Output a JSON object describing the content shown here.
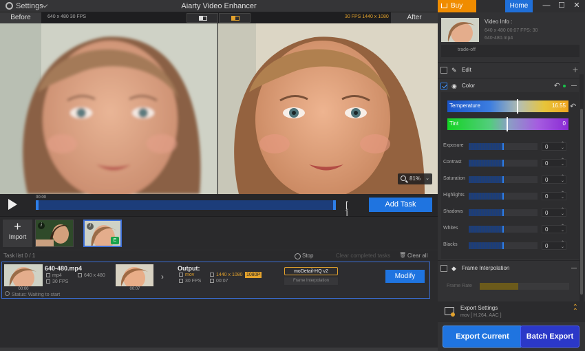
{
  "title_bar": {
    "settings_label": "Settings",
    "app_title": "Aiarty Video Enhancer",
    "buy_now": "Buy Now",
    "home": "Home",
    "minimize": "—",
    "maximize": "☐",
    "close": "✕"
  },
  "compare": {
    "before_label": "Before",
    "before_info": "640 x 480   30 FPS",
    "after_info": "30 FPS   1440 x 1080",
    "after_label": "After",
    "zoom": "81%"
  },
  "timeline": {
    "time_start": "00:00",
    "add_task": "Add Task",
    "in_out": "[ ]"
  },
  "media": {
    "import_label": "Import",
    "badge": "E",
    "info_glyph": "i"
  },
  "tasks": {
    "label": "Task list   0 / 1",
    "stop": "Stop",
    "clear_completed": "Clear completed tasks",
    "clear_all": "Clear all",
    "file_name": "640-480.mp4",
    "src_format": "mp4",
    "src_fps": "30 FPS",
    "src_res": "640 x 480",
    "thumb1_time": "00:00",
    "thumb2_time": "00:07",
    "output_label": "Output:",
    "out_format": "mov",
    "out_fps": "30 FPS",
    "out_res": "1440 x 1080",
    "out_badge": "1080P",
    "out_duration": "00:07",
    "model": "moDetail-HQ  v2",
    "frame_interp": "Frame Interpolation",
    "modify": "Modify",
    "status": "Status: Waiting to start"
  },
  "right_panel": {
    "video_info_title": "Video Info :",
    "video_info_line1": "640 x 480   00:07   FPS: 30",
    "video_info_line2": "640-480.mp4",
    "tradeoff": "trade-off",
    "edit_label": "Edit",
    "color_label": "Color",
    "temperature_label": "Temperature",
    "temperature_value": "16.55",
    "tint_label": "Tint",
    "tint_value": "0",
    "adjustments": [
      {
        "label": "Exposure",
        "value": "0"
      },
      {
        "label": "Contrast",
        "value": "0"
      },
      {
        "label": "Saturation",
        "value": "0"
      },
      {
        "label": "Highlights",
        "value": "0"
      },
      {
        "label": "Shadows",
        "value": "0"
      },
      {
        "label": "Whites",
        "value": "0"
      },
      {
        "label": "Blacks",
        "value": "0"
      }
    ],
    "frame_interp_label": "Frame Interpolation",
    "frame_rate_label": "Frame Rate",
    "export_settings_title": "Export Settings",
    "export_settings_sub": "mov [ H.264, AAC ]",
    "export_current": "Export Current",
    "batch_export": "Batch Export"
  },
  "colors": {
    "accent_blue": "#1f74e0",
    "accent_orange": "#f08c00",
    "batch_blue": "#2b38c8",
    "badge_green": "#18a24a"
  }
}
